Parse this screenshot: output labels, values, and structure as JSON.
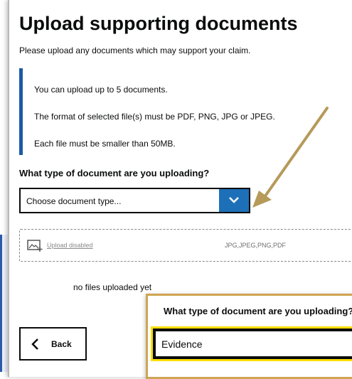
{
  "page": {
    "title": "Upload supporting documents",
    "intro": "Please upload any documents which may support your claim."
  },
  "inset": {
    "lines": [
      "You can upload up to 5 documents.",
      "The format of selected file(s) must be PDF, PNG, JPG or JPEG.",
      "Each file must be smaller than 50MB."
    ]
  },
  "document_type": {
    "question": "What type of document are you uploading?",
    "selected": "Choose document type..."
  },
  "upload": {
    "label": "Upload disabled",
    "formats": "JPG,JPEG,PNG,PDF"
  },
  "status": {
    "no_files": "no files uploaded yet"
  },
  "buttons": {
    "back": "Back"
  },
  "zoom": {
    "question": "What type of document are you uploading?",
    "value": "Evidence"
  },
  "colors": {
    "accent": "#1d70b8",
    "arrow": "#b59a5a",
    "highlight": "#ffdd00",
    "zoom_border": "#cfa553"
  },
  "icons": [
    "chevron-down-icon",
    "upload-image-icon",
    "chevron-left-icon"
  ]
}
